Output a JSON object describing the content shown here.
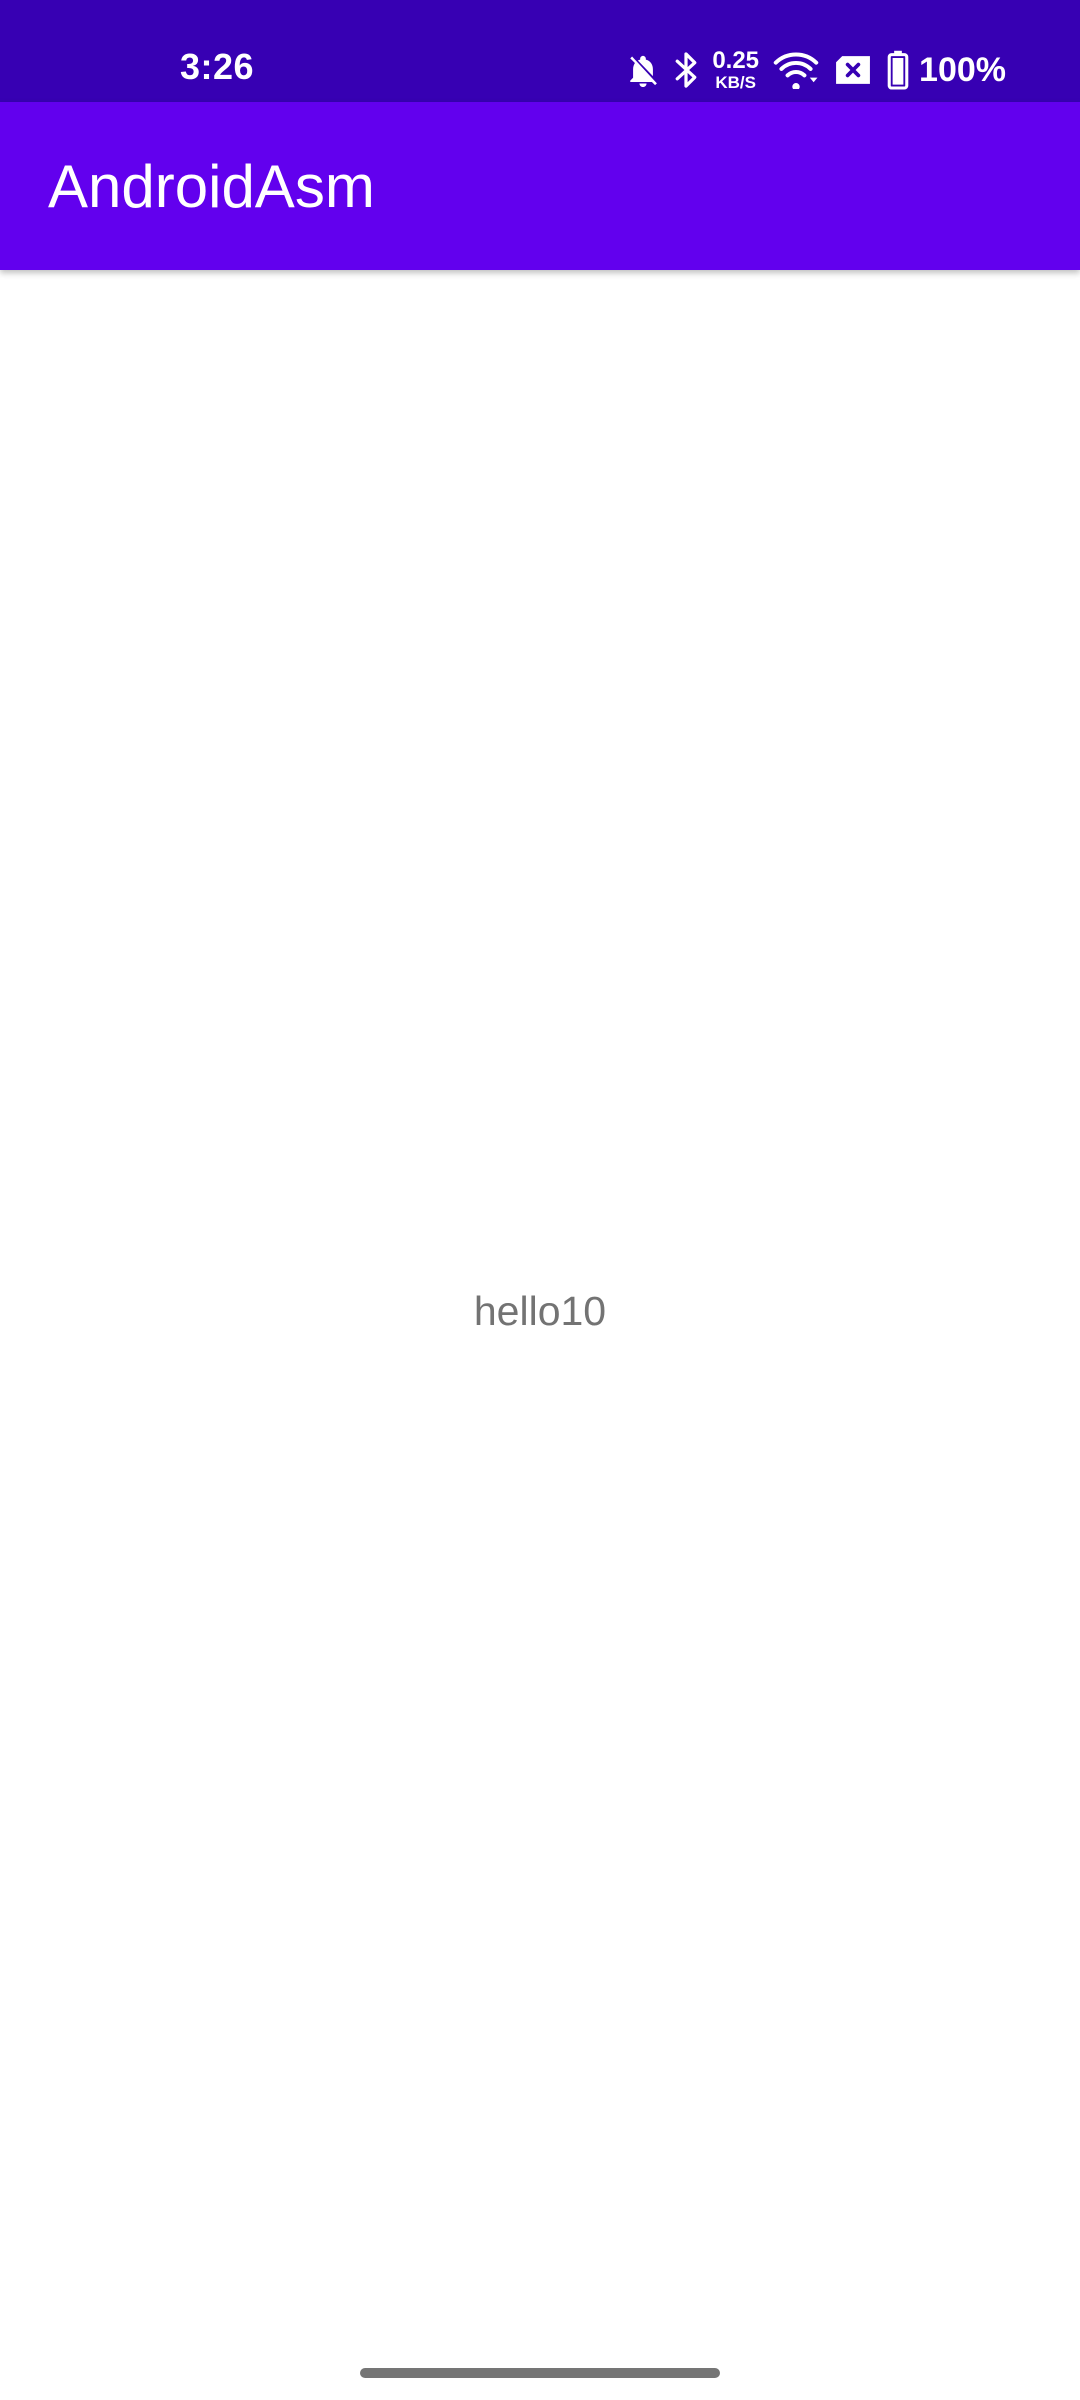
{
  "status_bar": {
    "time": "3:26",
    "net_speed_value": "0.25",
    "net_speed_unit": "KB/S",
    "battery_percent": "100%",
    "icons": [
      "bell-off-icon",
      "bluetooth-icon",
      "wifi-icon",
      "sim-error-icon",
      "battery-icon"
    ],
    "background_color": "#3700b3"
  },
  "app_bar": {
    "title": "AndroidAsm",
    "background_color": "#6200ee"
  },
  "content": {
    "text": "hello10"
  }
}
